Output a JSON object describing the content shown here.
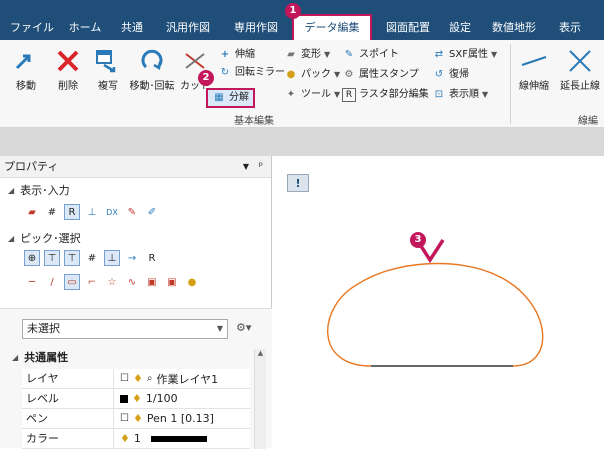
{
  "menu": {
    "tabs": [
      "ファイル",
      "ホーム",
      "共通",
      "汎用作図",
      "専用作図",
      "データ編集",
      "図面配置",
      "設定",
      "数値地形",
      "表示"
    ],
    "active_tab": "データ編集"
  },
  "ribbon": {
    "big_buttons": [
      "移動",
      "削除",
      "複写",
      "移動･回転",
      "カット"
    ],
    "small_col1": [
      "伸縮",
      "回転ミラー",
      "分解"
    ],
    "small_col2": [
      "変形",
      "パック",
      "ツール"
    ],
    "small_col3": [
      "スポイト",
      "属性スタンプ",
      "ラスタ部分編集"
    ],
    "small_col4": [
      "SXF属性",
      "復帰",
      "表示順"
    ],
    "right_buttons": [
      "線伸縮",
      "延長止線"
    ],
    "group_label": "基本編集",
    "group_label_right": "線編"
  },
  "annotations": [
    "1",
    "2",
    "3"
  ],
  "properties": {
    "title": "プロパティ",
    "pin": "ᵖ",
    "section_display": "表示･入力",
    "section_pick": "ピック･選択",
    "select_value": "未選択",
    "common_header": "共通属性",
    "rows": [
      {
        "name": "レイヤ",
        "value": "作業レイヤ1"
      },
      {
        "name": "レベル",
        "value": "1/100"
      },
      {
        "name": "ペン",
        "value": "Pen 1 [0.13]"
      },
      {
        "name": "カラー",
        "value": "1"
      }
    ]
  },
  "colors": {
    "menubar": "#1f4e79",
    "highlight": "#c2185b",
    "shape_stroke": "#e87722"
  }
}
